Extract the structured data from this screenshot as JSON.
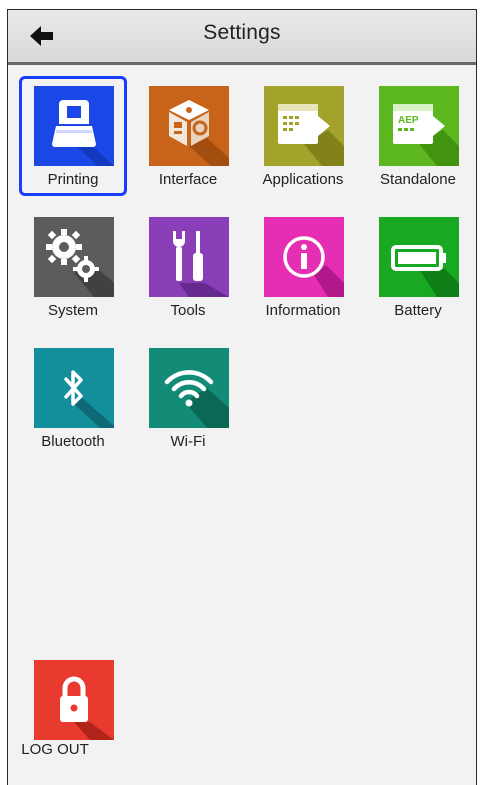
{
  "header": {
    "title": "Settings",
    "back_icon": "arrow-left-icon"
  },
  "tiles": [
    {
      "label": "Printing",
      "icon": "printer-icon",
      "color": "#1a47e5",
      "selected": true
    },
    {
      "label": "Interface",
      "icon": "interface-box-icon",
      "color": "#c8641a",
      "selected": false
    },
    {
      "label": "Applications",
      "icon": "application-export-icon",
      "color": "#a3a32b",
      "selected": false
    },
    {
      "label": "Standalone",
      "icon": "aep-export-icon",
      "color": "#5cb81e",
      "selected": false
    },
    {
      "label": "System",
      "icon": "gears-icon",
      "color": "#5c5c5c",
      "selected": false
    },
    {
      "label": "Tools",
      "icon": "wrench-screwdriver-icon",
      "color": "#8a3fb8",
      "selected": false
    },
    {
      "label": "Information",
      "icon": "info-icon",
      "color": "#e52eb4",
      "selected": false
    },
    {
      "label": "Battery",
      "icon": "battery-icon",
      "color": "#18a822",
      "selected": false
    },
    {
      "label": "Bluetooth",
      "icon": "bluetooth-icon",
      "color": "#138f9c",
      "selected": false
    },
    {
      "label": "Wi-Fi",
      "icon": "wifi-icon",
      "color": "#128c77",
      "selected": false
    }
  ],
  "logout": {
    "label": "LOG OUT",
    "icon": "lock-icon",
    "color": "#e83a2e"
  }
}
